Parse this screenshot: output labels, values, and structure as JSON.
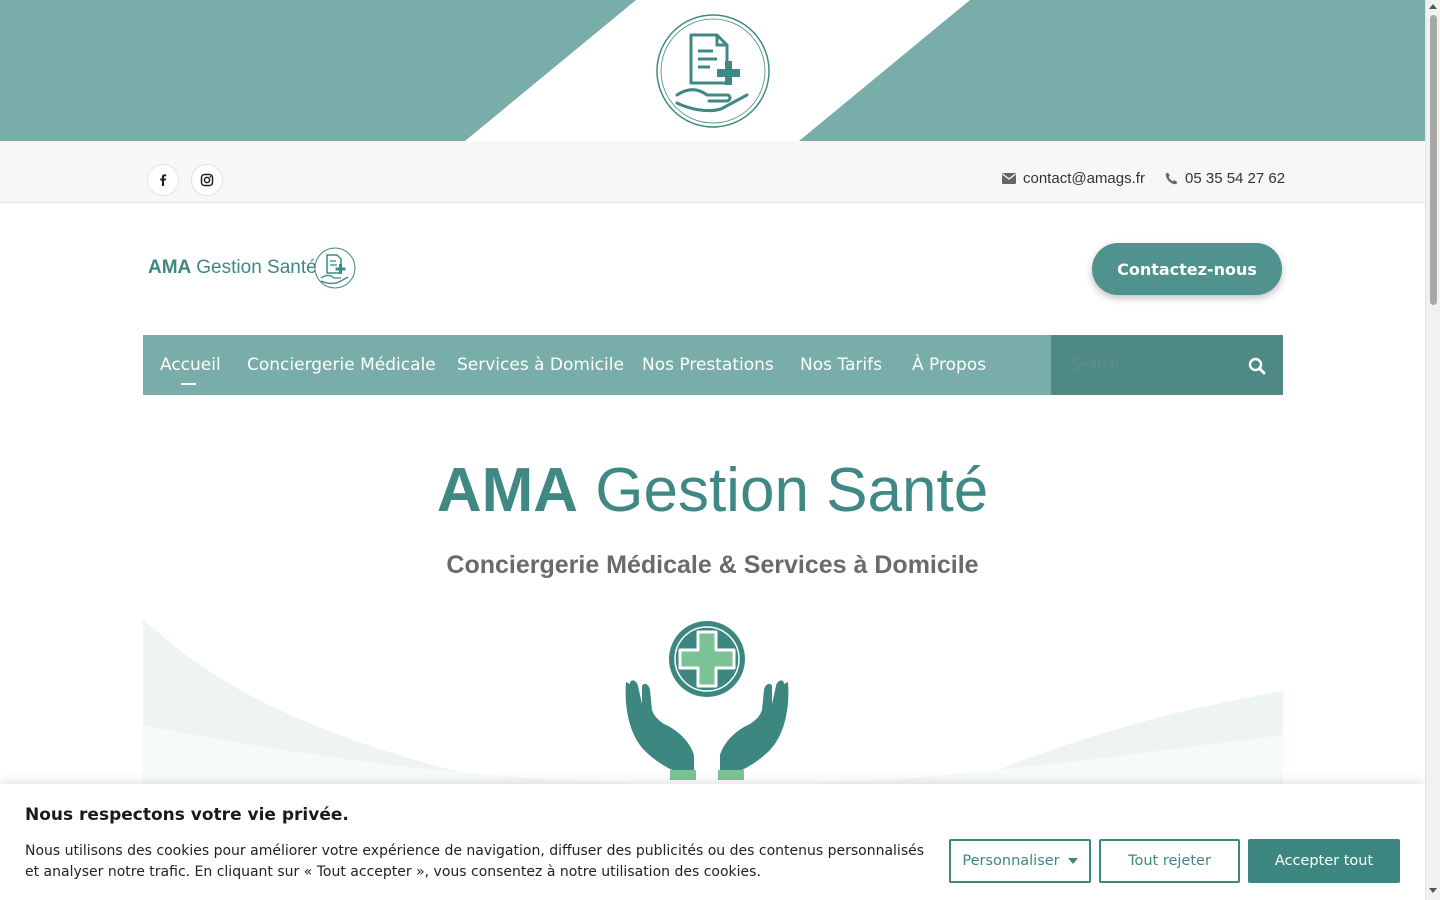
{
  "colors": {
    "brand": "#78ada9",
    "brand_dark": "#3d8781",
    "nav_search_bg": "#4e8985",
    "cta_bg": "#4f928e"
  },
  "banner": {
    "logo_icon": "medical-document-hand-icon"
  },
  "topbar": {
    "social": [
      {
        "icon": "facebook-icon"
      },
      {
        "icon": "instagram-icon"
      }
    ],
    "email": "contact@amags.fr",
    "phone": "05 35 54 27 62"
  },
  "header": {
    "logo_bold": "AMA",
    "logo_light": "Gestion Santé",
    "cta_label": "Contactez-nous"
  },
  "nav": {
    "items": [
      {
        "label": "Accueil",
        "active": true
      },
      {
        "label": "Conciergerie Médicale"
      },
      {
        "label": "Services à Domicile"
      },
      {
        "label": "Nos Prestations"
      },
      {
        "label": "Nos Tarifs"
      },
      {
        "label": "À Propos"
      }
    ],
    "search_placeholder": "Search"
  },
  "hero": {
    "title_bold": "AMA",
    "title_light": "Gestion Santé",
    "subtitle": "Conciergerie Médicale & Services à Domicile",
    "emblem_icon": "hands-holding-medical-cross-icon"
  },
  "cookie": {
    "title": "Nous respectons votre vie privée.",
    "text": "Nous utilisons des cookies pour améliorer votre expérience de navigation, diffuser des publicités ou des contenus personnalisés et analyser notre trafic. En cliquant sur « Tout accepter », vous consentez à notre utilisation des cookies.",
    "customize_label": "Personnaliser",
    "reject_label": "Tout rejeter",
    "accept_label": "Accepter tout"
  }
}
